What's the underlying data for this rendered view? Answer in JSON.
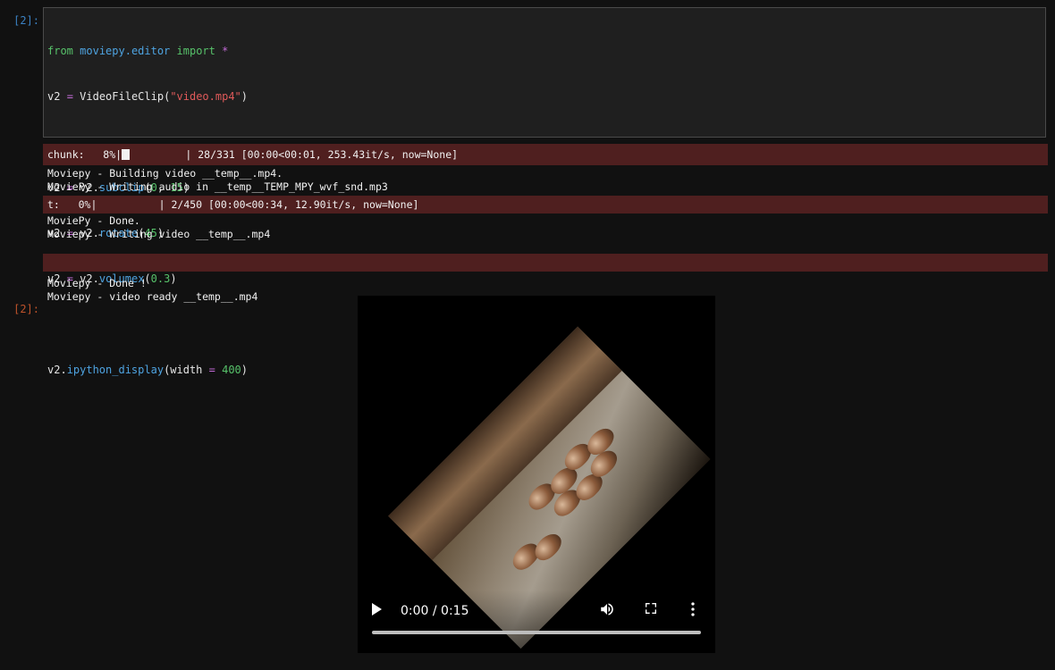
{
  "cells": {
    "in_prompt": "[2]:",
    "out_prompt": "[2]:"
  },
  "code": {
    "l1": {
      "kw1": "from",
      "mod": "moviepy.editor",
      "kw2": "import",
      "op": "*"
    },
    "l2": {
      "name": "v2",
      "op": "=",
      "fn": "VideoFileClip(",
      "str": "\"video.mp4\"",
      "close": ")"
    },
    "l4": {
      "name": "v2",
      "op": "=",
      "obj": "v2.",
      "attr": "subclip",
      "args_open": "(",
      "n1": "0",
      "sep": ", ",
      "n2": "15",
      "close": ")"
    },
    "l5": {
      "name": "v2",
      "op": "=",
      "obj": "v2.",
      "attr": "rotate",
      "args_open": "(",
      "n1": "45",
      "close": ")"
    },
    "l6": {
      "name": "v2",
      "op": "=",
      "obj": "v2.",
      "attr": "volumex",
      "args_open": "(",
      "n1": "0.3",
      "close": ")"
    },
    "l8": {
      "obj": "v2.",
      "attr": "ipython_display",
      "args_open": "(width ",
      "op": "=",
      "n1": "400",
      "close": ")"
    }
  },
  "output": {
    "chunk_progress": {
      "prefix": "chunk:   8%|",
      "suffix": "         | 28/331 [00:00<00:01, 253.43it/s, now=None]",
      "value": 0.08
    },
    "building": "Moviepy - Building video __temp__.mp4.",
    "writing_audio": "MoviePy - Writing audio in __temp__TEMP_MPY_wvf_snd.mp3",
    "t_progress": {
      "text": "t:   0%|          | 2/450 [00:00<00:34, 12.90it/s, now=None]",
      "value": 0.0
    },
    "done1": "MoviePy - Done.",
    "writing_video": "Moviepy - Writing video __temp__.mp4",
    "done2": "Moviepy - Done !",
    "ready": "Moviepy - video ready __temp__.mp4"
  },
  "video": {
    "time": "0:00 / 0:15",
    "progress": 0.0,
    "icons": [
      "play-icon",
      "volume-icon",
      "fullscreen-icon",
      "more-options-icon"
    ]
  },
  "colors": {
    "stderr_bg": "#4f1f1f",
    "prompt_in": "#3b82c4",
    "prompt_out": "#c0532b"
  }
}
